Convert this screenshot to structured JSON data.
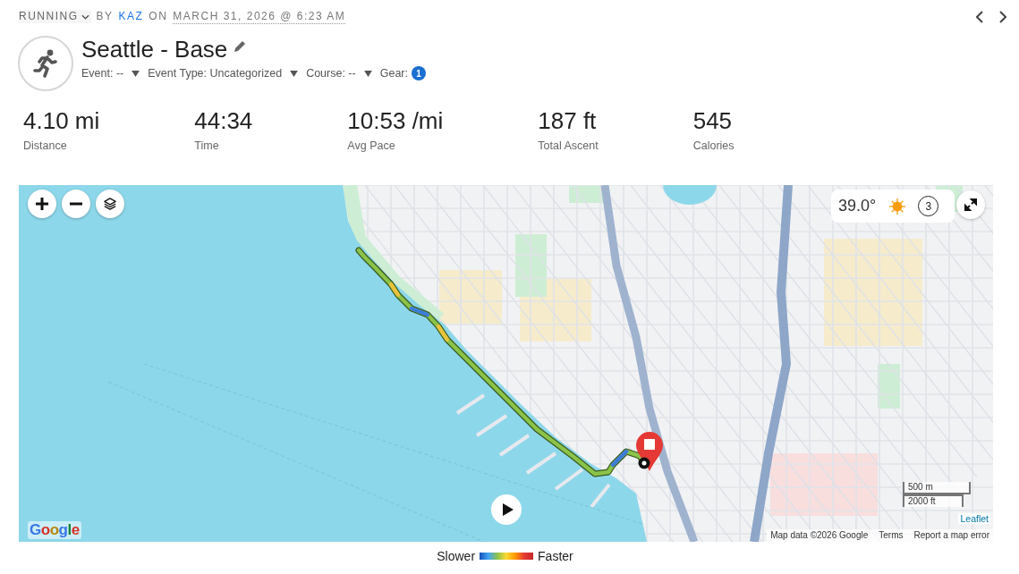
{
  "meta": {
    "sport": "RUNNING",
    "by": "BY",
    "author": "KAZ",
    "on": "ON",
    "date": "MARCH 31, 2026 @ 6:23 AM"
  },
  "activity": {
    "title": "Seattle - Base",
    "fields": [
      {
        "kind": "dropdown",
        "label": "Event: --"
      },
      {
        "kind": "dropdown",
        "label": "Event Type: Uncategorized"
      },
      {
        "kind": "dropdown",
        "label": "Course: --"
      },
      {
        "kind": "badge",
        "label": "Gear:",
        "count": "1"
      }
    ]
  },
  "stats": [
    {
      "value": "4.10 mi",
      "label": "Distance"
    },
    {
      "value": "44:34",
      "label": "Time"
    },
    {
      "value": "10:53 /mi",
      "label": "Avg Pace"
    },
    {
      "value": "187 ft",
      "label": "Total Ascent"
    },
    {
      "value": "545",
      "label": "Calories"
    }
  ],
  "map": {
    "weather": {
      "temperature": "39.0°",
      "circled_number": "3"
    },
    "scale": [
      "500 m",
      "2000 ft"
    ],
    "logo": "Google",
    "leaflet": "Leaflet",
    "attribution": [
      "Map data ©2026 Google",
      "Terms",
      "Report a map error"
    ]
  },
  "legend": {
    "slower": "Slower",
    "faster": "Faster"
  }
}
